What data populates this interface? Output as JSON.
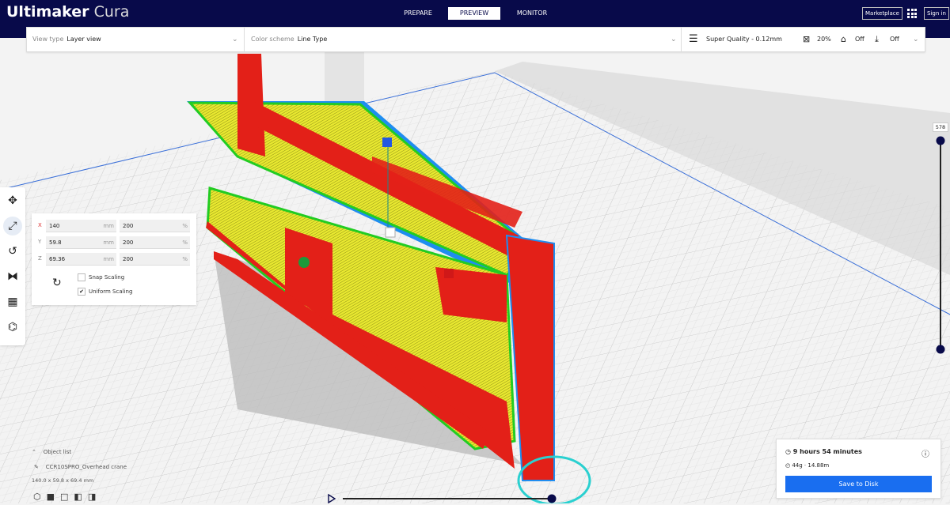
{
  "header": {
    "logo_bold": "Ultimaker",
    "logo_light": " Cura",
    "tabs": [
      {
        "label": "PREPARE"
      },
      {
        "label": "PREVIEW",
        "active": true
      },
      {
        "label": "MONITOR"
      }
    ],
    "marketplace": "Marketplace",
    "signin": "Sign in",
    "bg_color": "#080a4a"
  },
  "toolbar": {
    "view_type_label": "View type",
    "view_type_value": "Layer view",
    "color_scheme_label": "Color scheme",
    "color_scheme_value": "Line Type",
    "quality": "Super Quality - 0.12mm",
    "infill": "20%",
    "support": "Off",
    "adhesion": "Off"
  },
  "layer_slider": {
    "value": "578",
    "max_level": 1.0
  },
  "tools": [
    "move-icon",
    "scale-icon",
    "rotate-icon",
    "mirror-icon",
    "per-model-settings-icon",
    "support-blocker-icon"
  ],
  "scale_panel": {
    "rows": [
      {
        "axis": "X",
        "mm": "140",
        "pct": "200"
      },
      {
        "axis": "Y",
        "mm": "59.8",
        "pct": "200"
      },
      {
        "axis": "Z",
        "mm": "69.36",
        "pct": "200"
      }
    ],
    "mm_unit": "mm",
    "pct_unit": "%",
    "snap_label": "Snap Scaling",
    "snap_checked": false,
    "uniform_label": "Uniform Scaling",
    "uniform_checked": true,
    "check_mark": "✔"
  },
  "object_list": {
    "title": "Object list",
    "object_name": "CCR10SPRO_Overhead crane",
    "dimensions": "140.0 x 59.8 x 69.4 mm"
  },
  "stats": {
    "time": "9 hours 54 minutes",
    "material": "44g · 14.88m",
    "save_label": "Save to Disk",
    "accent": "#196ef0"
  },
  "playback": {
    "progress": 1.0
  }
}
